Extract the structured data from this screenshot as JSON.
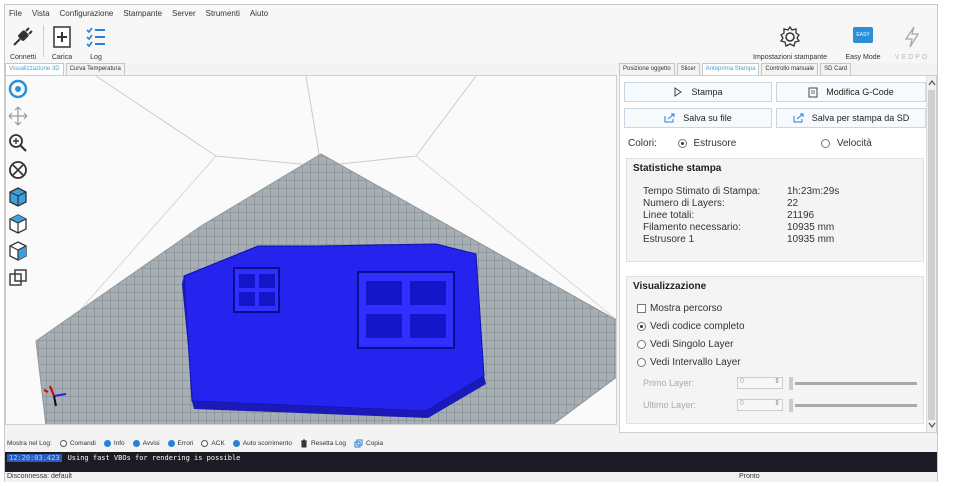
{
  "menu": [
    "File",
    "Vista",
    "Configurazione",
    "Stampante",
    "Server",
    "Strumenti",
    "Aiuto"
  ],
  "toolbar": {
    "connect_label": "Connetti",
    "load_label": "Carica",
    "log_label": "Log",
    "printer_settings_label": "Impostazioni stampante",
    "easy_mode_label": "Easy Mode",
    "easy_badge": "EASY",
    "brand_text": "VEDPO"
  },
  "left_tabs": [
    {
      "label": "Visualizzazione 3D",
      "active": true
    },
    {
      "label": "Curva Temperatura",
      "active": false
    }
  ],
  "right_tabs": [
    {
      "label": "Posizione oggetto",
      "active": false
    },
    {
      "label": "Slicer",
      "active": false
    },
    {
      "label": "Anteprima Stampa",
      "active": true
    },
    {
      "label": "Controllo manuale",
      "active": false
    },
    {
      "label": "SD Card",
      "active": false
    }
  ],
  "panel": {
    "print_btn": "Stampa",
    "edit_gcode_btn": "Modifica G-Code",
    "save_file_btn": "Salva su file",
    "save_sd_btn": "Salva per stampa da SD",
    "colors_label": "Colori:",
    "color_extruder": "Estrusore",
    "color_speed": "Velocità",
    "color_selected": "Estrusore",
    "stats_title": "Statistiche stampa",
    "stats": [
      {
        "k": "Tempo Stimato di Stampa:",
        "v": "1h:23m:29s"
      },
      {
        "k": "Numero di Layers:",
        "v": "22"
      },
      {
        "k": "Linee totali:",
        "v": "21196"
      },
      {
        "k": "Filamento necessario:",
        "v": "10935 mm"
      },
      {
        "k": "Estrusore 1",
        "v": "10935 mm"
      }
    ],
    "vis_title": "Visualizzazione",
    "show_path": "Mostra percorso",
    "show_path_checked": false,
    "vis_full": "Vedi codice completo",
    "vis_single": "Vedi Singolo Layer",
    "vis_range": "Vedi Intervallo Layer",
    "vis_selected": "Vedi codice completo",
    "first_layer": "Primo Layer:",
    "last_layer": "Ultimo Layer:",
    "first_layer_val": "0",
    "last_layer_val": "0"
  },
  "logbar": {
    "show_label": "Mostra nel Log:",
    "commands": "Comandi",
    "info": "Info",
    "warnings": "Avvisi",
    "errors": "Errori",
    "ack": "ACK",
    "autoscroll": "Auto scorrimento",
    "reset_log": "Resetta Log",
    "copy": "Copia"
  },
  "console": {
    "timestamp": "12:20:03.423",
    "message": "Using fast VBOs for rendering is possible"
  },
  "status": {
    "left": "Disconnessa: default",
    "right": "Pronto"
  },
  "colors": {
    "accent": "#4a9fd8",
    "model_blue": "#2222ee",
    "grid_bed": "#9ea6ab"
  }
}
